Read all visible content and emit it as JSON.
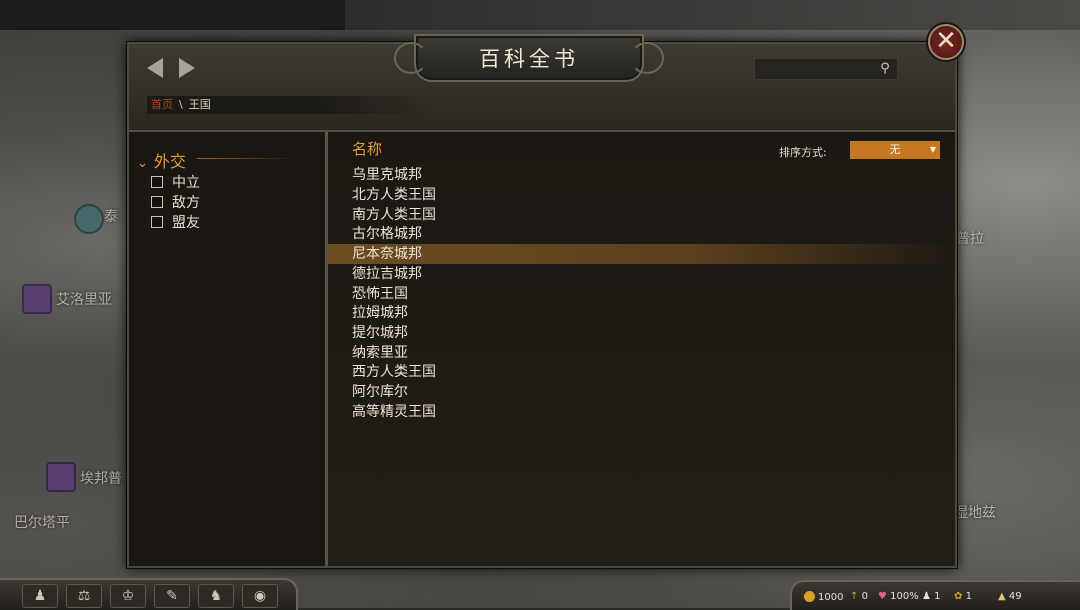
{
  "window": {
    "title": "百科全书",
    "close_glyph": "✕"
  },
  "breadcrumb": {
    "home": "首页",
    "separator": "\\",
    "current": "王国"
  },
  "search": {
    "placeholder": "",
    "icon": "search-icon"
  },
  "filters": {
    "group_title": "外交",
    "items": [
      {
        "label": "中立",
        "checked": false
      },
      {
        "label": "敌方",
        "checked": false
      },
      {
        "label": "盟友",
        "checked": false
      }
    ]
  },
  "list": {
    "column_header": "名称",
    "sort_label": "排序方式:",
    "sort_value": "无",
    "selected_index": 4,
    "rows": [
      "乌里克城邦",
      "北方人类王国",
      "南方人类王国",
      "古尔格城邦",
      "尼本奈城邦",
      "德拉吉城邦",
      "恐怖王国",
      "拉姆城邦",
      "提尔城邦",
      "纳索里亚",
      "西方人类王国",
      "阿尔库尔",
      "高等精灵王国"
    ]
  },
  "map_labels": {
    "l1": "艾洛里亚",
    "l2": "埃邦普",
    "l3": "巴尔塔平",
    "l4": "普拉",
    "l5": "湿地兹",
    "l6": "泰"
  },
  "status_bar": {
    "gold": "1000",
    "influence": "0",
    "health": "100%",
    "troops": "1",
    "food": "1",
    "party": "49"
  },
  "colors": {
    "accent": "#e39a3a",
    "selection": "#6e4c22",
    "sort_dropdown": "#c4781f",
    "crumb_home": "#a24a2a"
  }
}
